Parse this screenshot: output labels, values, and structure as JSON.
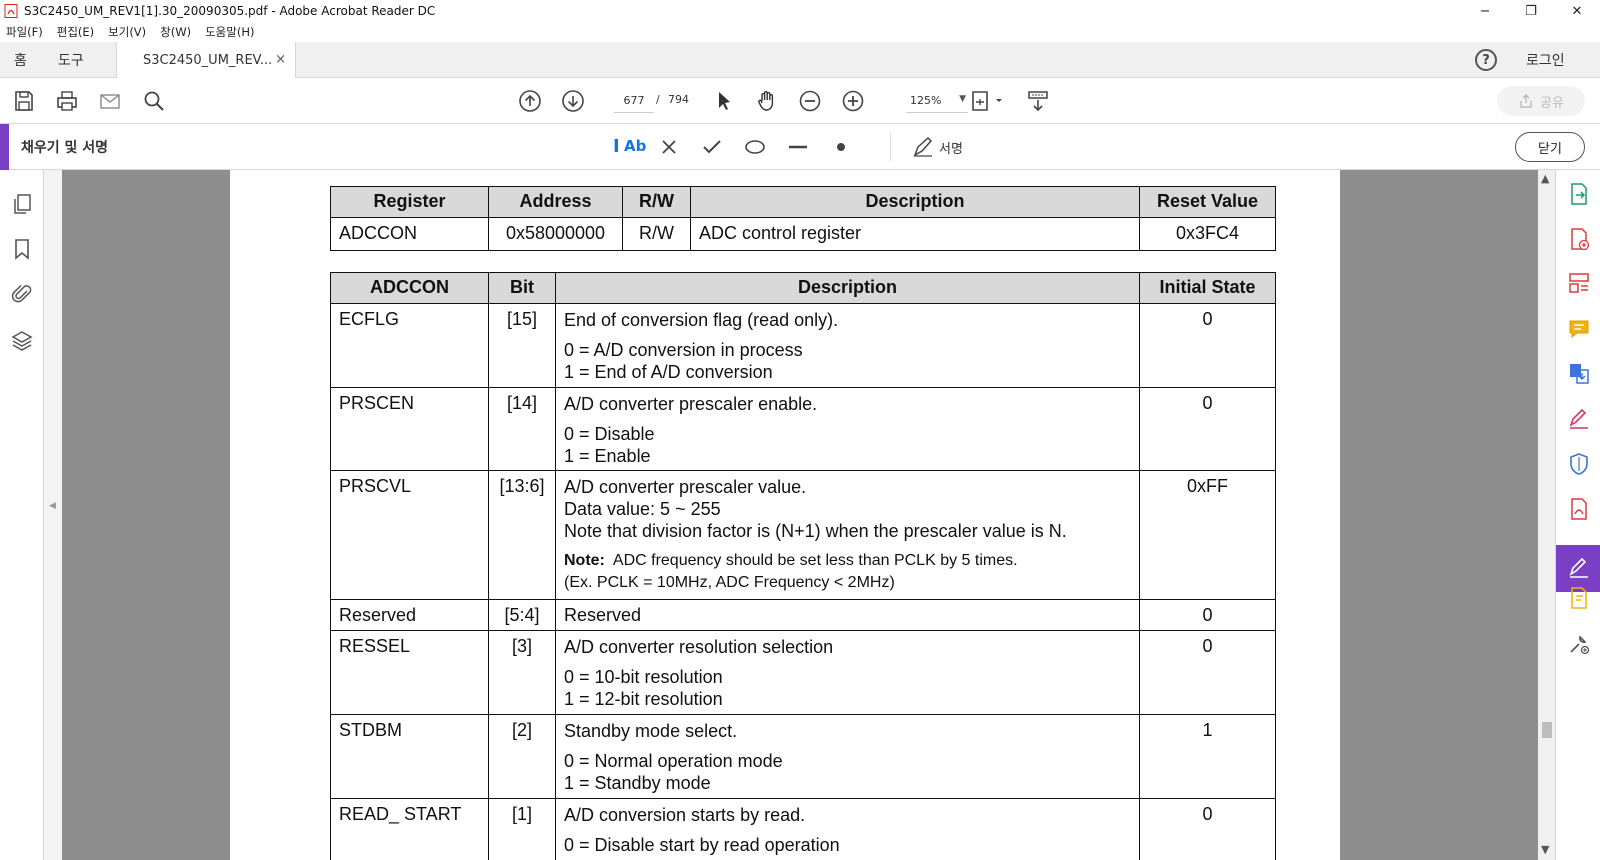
{
  "window": {
    "title": "S3C2450_UM_REV1[1].30_20090305.pdf - Adobe Acrobat Reader DC",
    "minimize": "−",
    "maximize": "❐",
    "close": "✕"
  },
  "menu": [
    "파일(F)",
    "편집(E)",
    "보기(V)",
    "창(W)",
    "도움말(H)"
  ],
  "tabs": {
    "home": "홈",
    "tools": "도구",
    "document": "S3C2450_UM_REV...",
    "close": "×",
    "help": "?",
    "login": "로그인"
  },
  "toolbar": {
    "current_page": "677",
    "page_separator": "/",
    "total_pages": "794",
    "zoom": "125%",
    "share": "공유"
  },
  "fill_sign": {
    "title": "채우기 및 서명",
    "text_tool": "Ab",
    "sign": "서명",
    "close": "닫기"
  },
  "register_table": {
    "headers": [
      "Register",
      "Address",
      "R/W",
      "Description",
      "Reset Value"
    ],
    "row": [
      "ADCCON",
      "0x58000000",
      "R/W",
      "ADC control register",
      "0x3FC4"
    ]
  },
  "bit_table": {
    "headers": [
      "ADCCON",
      "Bit",
      "Description",
      "Initial State"
    ],
    "rows": [
      {
        "name": "ECFLG",
        "bit": "[15]",
        "desc": "End of conversion flag (read only).",
        "opts": [
          "0 = A/D conversion in process",
          "1 = End of A/D conversion"
        ],
        "init": "0"
      },
      {
        "name": "PRSCEN",
        "bit": "[14]",
        "desc": "A/D converter prescaler enable.",
        "opts": [
          "0 = Disable",
          "1 = Enable"
        ],
        "init": "0"
      },
      {
        "name": "PRSCVL",
        "bit": "[13:6]",
        "desc": "A/D converter prescaler value.",
        "lines": [
          "Data value: 5 ~ 255",
          "Note that division factor is (N+1) when the prescaler value is N."
        ],
        "note_label": "Note:",
        "note_text": "ADC frequency should be set less than PCLK by 5 times.",
        "note_ex": "(Ex. PCLK = 10MHz, ADC Frequency < 2MHz)",
        "init": "0xFF"
      },
      {
        "name": "Reserved",
        "bit": "[5:4]",
        "desc": "Reserved",
        "init": "0"
      },
      {
        "name": "RESSEL",
        "bit": "[3]",
        "desc": "A/D converter resolution selection",
        "opts": [
          "0 = 10-bit resolution",
          "1 = 12-bit resolution"
        ],
        "init": "0"
      },
      {
        "name": "STDBM",
        "bit": "[2]",
        "desc": "Standby mode select.",
        "opts": [
          "0 = Normal operation mode",
          "1 = Standby mode"
        ],
        "init": "1"
      },
      {
        "name": "READ_ START",
        "bit": "[1]",
        "desc": "A/D conversion starts by read.",
        "opts": [
          "0 = Disable start by read operation"
        ],
        "init": "0"
      }
    ]
  },
  "colors": {
    "accent": "#7b3fc6",
    "link_blue": "#1473e6",
    "doc_background": "#8e8e8e",
    "header_fill": "#d9d9d9"
  }
}
